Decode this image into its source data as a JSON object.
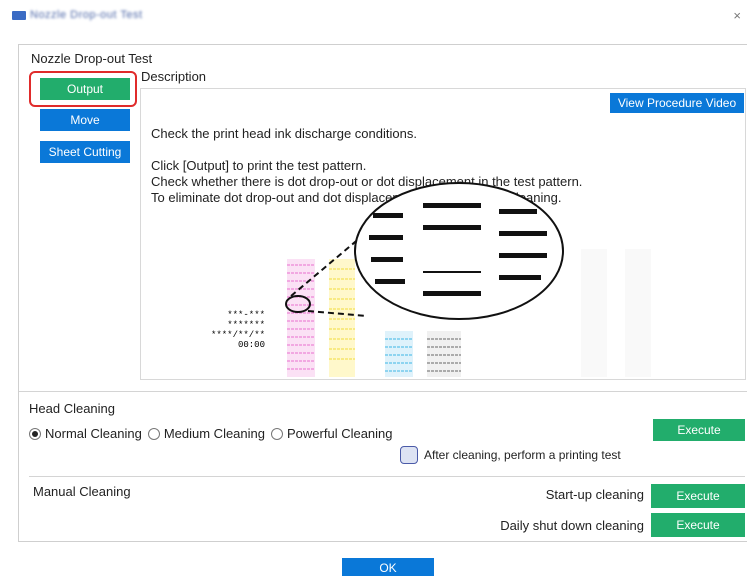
{
  "window": {
    "title": "Nozzle Drop-out Test"
  },
  "nozzle": {
    "title": "Nozzle Drop-out Test",
    "buttons": {
      "output": "Output",
      "move": "Move",
      "sheet_cutting": "Sheet Cutting"
    },
    "description": {
      "title": "Description",
      "video_button": "View Procedure Video",
      "lines": [
        "Check the print head ink discharge conditions.",
        "Click [Output] to print the test pattern.",
        "Check whether there is dot drop-out or dot displacement in the test pattern.",
        "To eliminate dot drop-out and dot displacement, perform head cleaning."
      ],
      "pattern_labels": [
        "***-***",
        "*******",
        "****/**/**",
        "00:00"
      ]
    }
  },
  "head_cleaning": {
    "title": "Head Cleaning",
    "options": [
      "Normal Cleaning",
      "Medium Cleaning",
      "Powerful Cleaning"
    ],
    "selected": "Normal Cleaning",
    "execute": "Execute",
    "after_test_label": "After cleaning, perform a printing test"
  },
  "manual_cleaning": {
    "title": "Manual Cleaning",
    "startup_label": "Start-up cleaning",
    "shutdown_label": "Daily shut down cleaning",
    "execute": "Execute"
  },
  "footer": {
    "ok": "OK"
  }
}
